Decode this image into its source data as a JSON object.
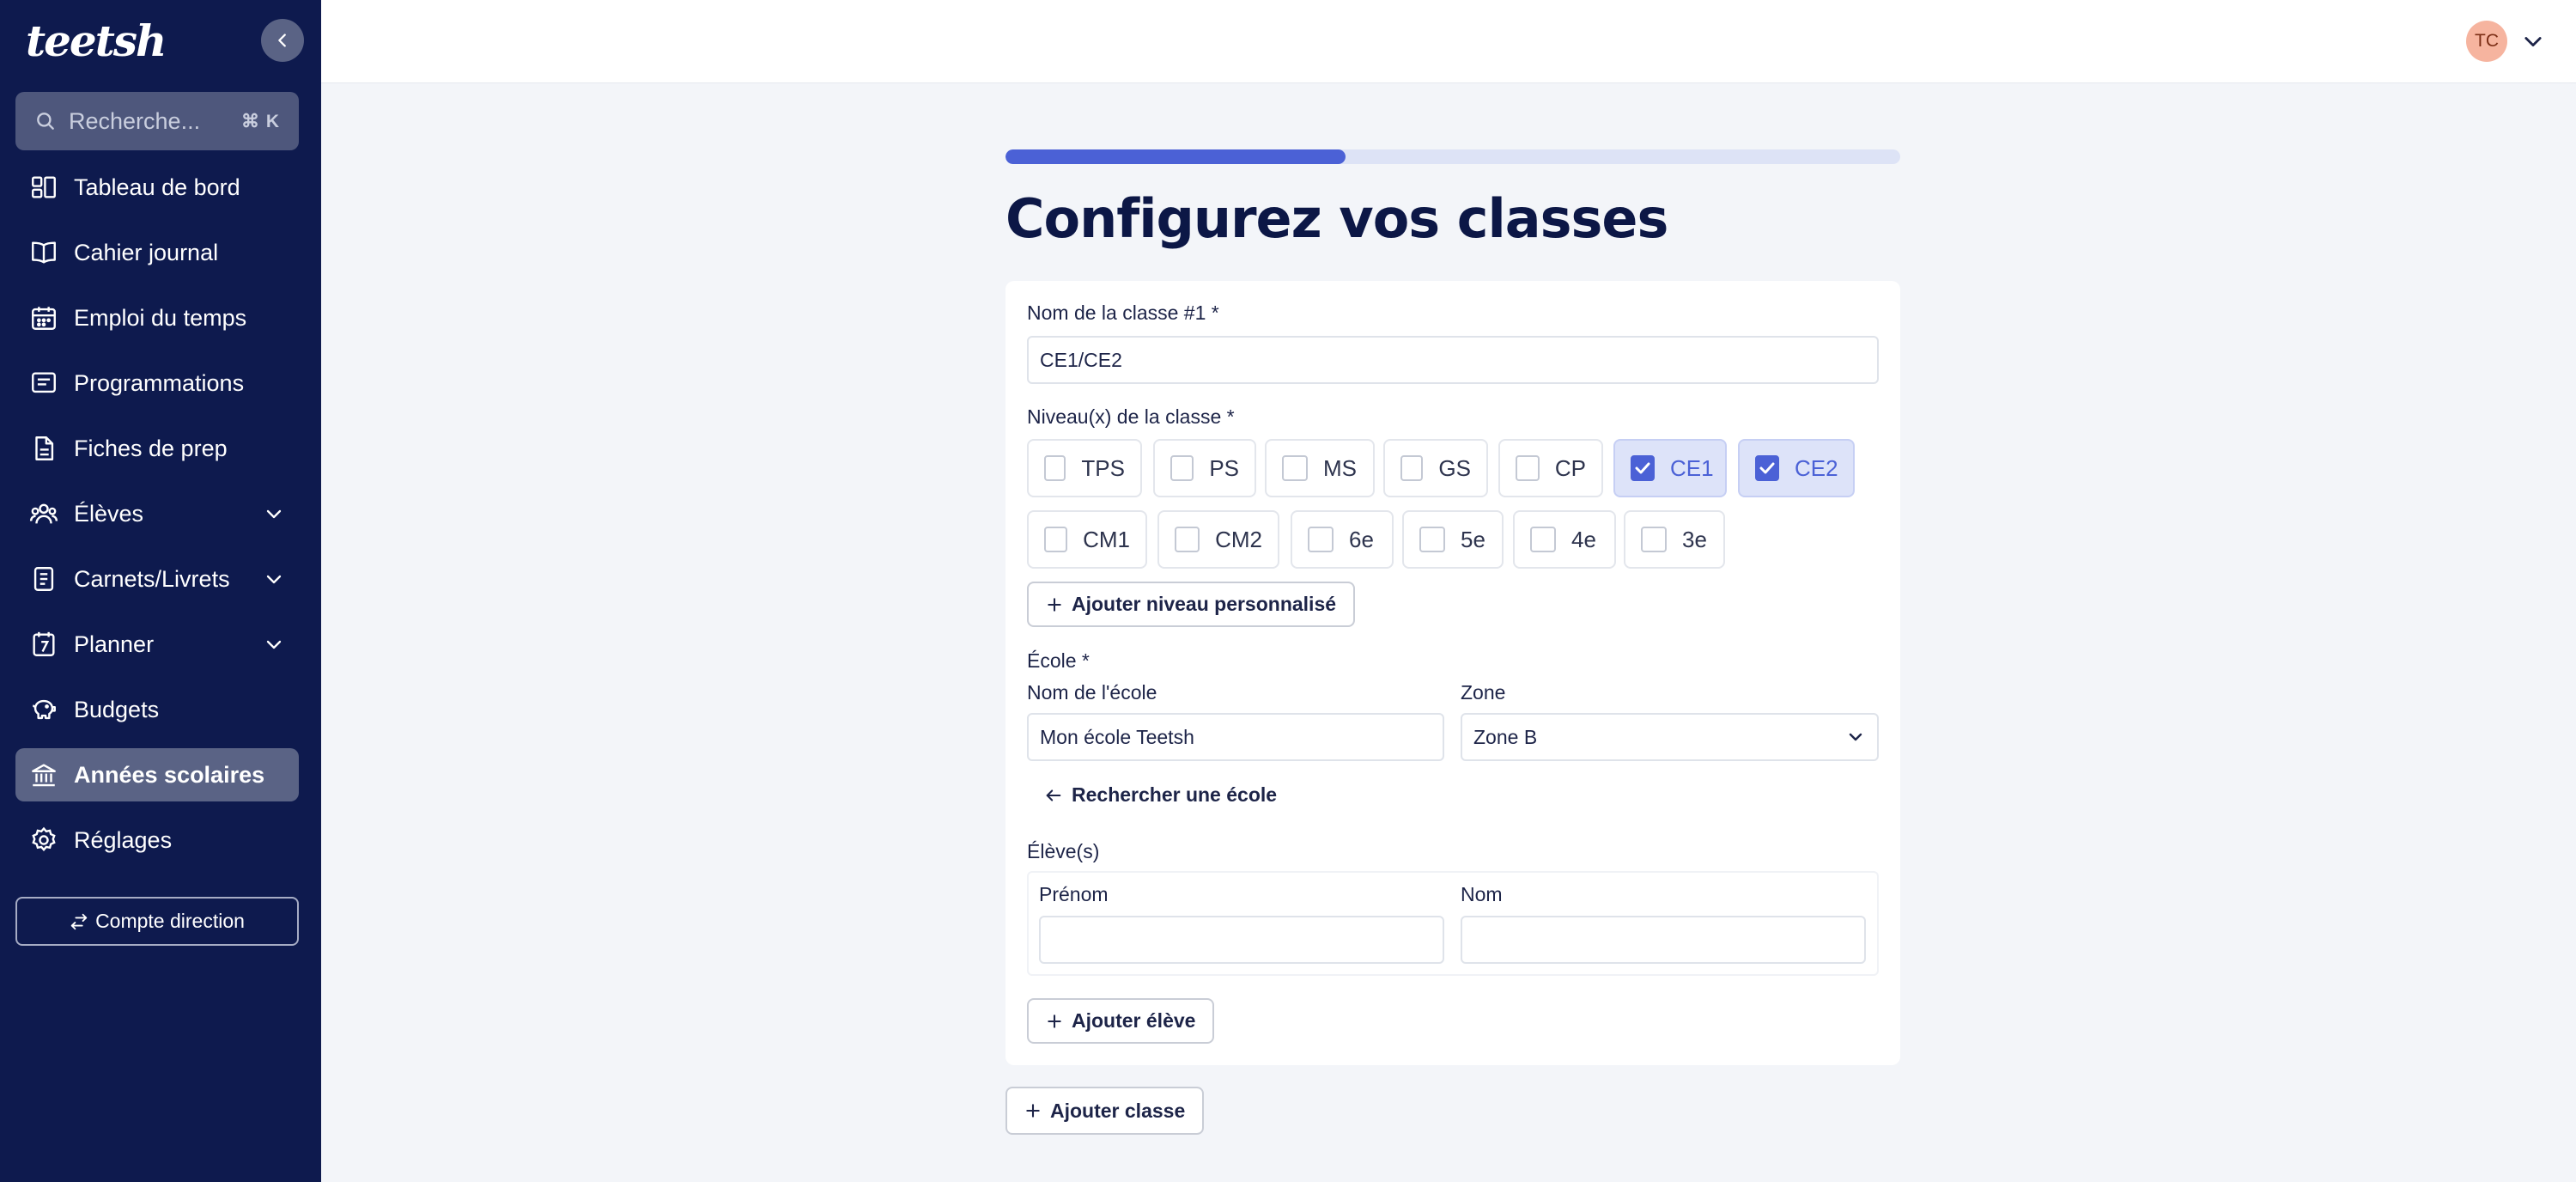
{
  "app": {
    "logo": "teetsh"
  },
  "sidebar": {
    "search": {
      "placeholder": "Recherche...",
      "shortcut": "⌘ K"
    },
    "items": [
      {
        "label": "Tableau de bord",
        "icon": "dashboard-icon"
      },
      {
        "label": "Cahier journal",
        "icon": "book-icon"
      },
      {
        "label": "Emploi du temps",
        "icon": "calendar-icon"
      },
      {
        "label": "Programmations",
        "icon": "presentation-icon"
      },
      {
        "label": "Fiches de prep",
        "icon": "document-icon"
      },
      {
        "label": "Élèves",
        "icon": "users-icon",
        "expandable": true
      },
      {
        "label": "Carnets/Livrets",
        "icon": "notebook-icon",
        "expandable": true
      },
      {
        "label": "Planner",
        "icon": "planner-icon",
        "expandable": true
      },
      {
        "label": "Budgets",
        "icon": "piggy-bank-icon"
      },
      {
        "label": "Années scolaires",
        "icon": "school-icon",
        "active": true
      },
      {
        "label": "Réglages",
        "icon": "gear-icon"
      }
    ],
    "direction_button": "Compte direction"
  },
  "topbar": {
    "avatar_initials": "TC"
  },
  "main": {
    "progress": 0.38,
    "title": "Configurez vos classes",
    "class_form": {
      "name_label": "Nom de la classe #1 *",
      "name_value": "CE1/CE2",
      "levels_label": "Niveau(x) de la classe *",
      "levels_row1": [
        {
          "label": "TPS",
          "checked": false
        },
        {
          "label": "PS",
          "checked": false
        },
        {
          "label": "MS",
          "checked": false
        },
        {
          "label": "GS",
          "checked": false
        },
        {
          "label": "CP",
          "checked": false
        },
        {
          "label": "CE1",
          "checked": true
        },
        {
          "label": "CE2",
          "checked": true
        }
      ],
      "levels_row2": [
        {
          "label": "CM1",
          "checked": false
        },
        {
          "label": "CM2",
          "checked": false
        },
        {
          "label": "6e",
          "checked": false
        },
        {
          "label": "5e",
          "checked": false
        },
        {
          "label": "4e",
          "checked": false
        },
        {
          "label": "3e",
          "checked": false
        }
      ],
      "add_level_button": "Ajouter niveau personnalisé",
      "school_label": "École *",
      "school_name_label": "Nom de l'école",
      "school_name_value": "Mon école Teetsh",
      "zone_label": "Zone",
      "zone_value": "Zone B",
      "search_school_link": "Rechercher une école",
      "students_label": "Élève(s)",
      "first_name_label": "Prénom",
      "first_name_value": "",
      "last_name_label": "Nom",
      "last_name_value": "",
      "add_student_button": "Ajouter élève"
    },
    "add_class_button": "Ajouter classe"
  },
  "colors": {
    "sidebar_bg": "#0e1a4e",
    "accent": "#4b61d6",
    "page_bg": "#f3f5f9"
  }
}
